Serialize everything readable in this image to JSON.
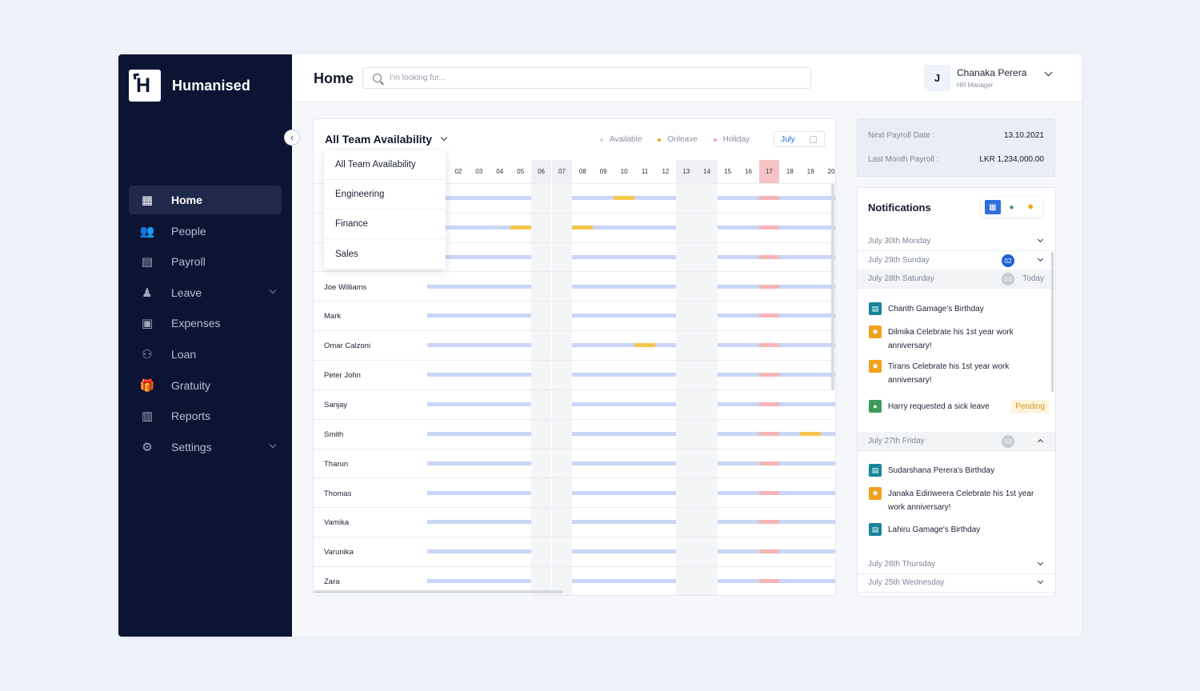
{
  "app": {
    "name": "Humanised",
    "logo_letter": "H"
  },
  "sidebar": {
    "items": [
      {
        "label": "Home",
        "icon": "dashboard-icon",
        "glyph": "▦",
        "active": true,
        "has_chevron": false
      },
      {
        "label": "People",
        "icon": "people-icon",
        "glyph": "👥",
        "active": false,
        "has_chevron": false
      },
      {
        "label": "Payroll",
        "icon": "payroll-icon",
        "glyph": "▤",
        "active": false,
        "has_chevron": false
      },
      {
        "label": "Leave",
        "icon": "leave-icon",
        "glyph": "♟",
        "active": false,
        "has_chevron": true
      },
      {
        "label": "Expenses",
        "icon": "expenses-icon",
        "glyph": "▣",
        "active": false,
        "has_chevron": false
      },
      {
        "label": "Loan",
        "icon": "loan-icon",
        "glyph": "⚇",
        "active": false,
        "has_chevron": false
      },
      {
        "label": "Gratuity",
        "icon": "gift-icon",
        "glyph": "🎁",
        "active": false,
        "has_chevron": false
      },
      {
        "label": "Reports",
        "icon": "chart-icon",
        "glyph": "▥",
        "active": false,
        "has_chevron": false
      },
      {
        "label": "Settings",
        "icon": "gear-icon",
        "glyph": "⚙",
        "active": false,
        "has_chevron": true
      }
    ]
  },
  "header": {
    "title": "Home",
    "search_placeholder": "I'm looking for...",
    "user": {
      "initial": "J",
      "name": "Chanaka Perera",
      "role": "HR Manager"
    }
  },
  "availability": {
    "title": "All Team Availability",
    "legend": [
      {
        "label": "Available",
        "color": "#c9d6f5"
      },
      {
        "label": "Onleave",
        "color": "#f0a21b"
      },
      {
        "label": "Holiday",
        "color": "#f3a7ab"
      }
    ],
    "month": "July",
    "dropdown_options": [
      "All Team Availability",
      "Engineering",
      "Finance",
      "Sales"
    ],
    "days": [
      "02",
      "03",
      "04",
      "05",
      "06",
      "07",
      "08",
      "09",
      "10",
      "11",
      "12",
      "13",
      "14",
      "15",
      "16",
      "17",
      "18",
      "19",
      "20"
    ],
    "weekend_days": [
      "06",
      "07",
      "13",
      "14"
    ],
    "holiday_days": [
      "17"
    ],
    "rows": [
      {
        "name": "",
        "leave_days": [
          "10"
        ]
      },
      {
        "name": "",
        "leave_days": [
          "05",
          "08"
        ]
      },
      {
        "name": "",
        "leave_days": []
      },
      {
        "name": "Joe Williams",
        "leave_days": []
      },
      {
        "name": "Mark",
        "leave_days": []
      },
      {
        "name": "Omar Calzoni",
        "leave_days": [
          "11"
        ]
      },
      {
        "name": "Peter John",
        "leave_days": []
      },
      {
        "name": "Sanjay",
        "leave_days": []
      },
      {
        "name": "Smith",
        "leave_days": [
          "19"
        ]
      },
      {
        "name": "Tharun",
        "leave_days": []
      },
      {
        "name": "Thomas",
        "leave_days": []
      },
      {
        "name": "Vamika",
        "leave_days": []
      },
      {
        "name": "Varunika",
        "leave_days": []
      },
      {
        "name": "Zara",
        "leave_days": []
      }
    ]
  },
  "payroll": {
    "next_label": "Next Payroll Date :",
    "next_value": "13.10.2021",
    "last_label": "Last Month Payroll :",
    "last_value": "LKR 1,234,000.00"
  },
  "notifications": {
    "title": "Notifications",
    "days": [
      {
        "label": "July 30th Monday"
      },
      {
        "label": "July 29th Sunday",
        "count": "02"
      },
      {
        "label": "July 28th Saturday",
        "count": "04",
        "extra": "Today"
      },
      {
        "label": "July 27th Friday",
        "count": "03"
      },
      {
        "label": "July 26th Thursday"
      },
      {
        "label": "July 25th Wednesday"
      }
    ],
    "items_28": [
      {
        "text": "Charith Gamage's Birthday",
        "icon": "birthday-cake-icon"
      },
      {
        "text": "Dilmika Celebrate his 1st year work anniversary!",
        "icon": "anniversary-icon"
      },
      {
        "text": "Tirans Celebrate his 1st year work anniversary!",
        "icon": "anniversary-icon"
      },
      {
        "text": "Harry requested a sick leave",
        "icon": "leave-request-icon",
        "status": "Pending"
      }
    ],
    "items_27": [
      {
        "text": "Sudarshana Perera's Birthday",
        "icon": "birthday-cake-icon"
      },
      {
        "text": "Janaka Ediriweera Celebrate his 1st year work anniversary!",
        "icon": "anniversary-icon"
      },
      {
        "text": "Lahiru Gamage's Birthday",
        "icon": "birthday-cake-icon"
      }
    ]
  }
}
